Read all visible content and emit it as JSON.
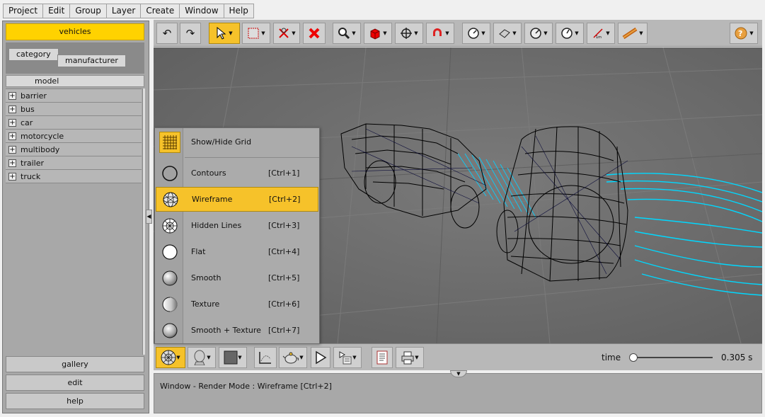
{
  "menubar": [
    "Project",
    "Edit",
    "Group",
    "Layer",
    "Create",
    "Window",
    "Help"
  ],
  "sidebar": {
    "active_tab": "vehicles",
    "filters": [
      "category",
      "manufacturer"
    ],
    "column_header": "model",
    "tree_items": [
      "barrier",
      "bus",
      "car",
      "motorcycle",
      "multibody",
      "trailer",
      "truck"
    ],
    "bottom_buttons": [
      "gallery",
      "edit",
      "help"
    ]
  },
  "render_menu": {
    "items": [
      {
        "label": "Show/Hide Grid",
        "shortcut": "",
        "icon": "grid-icon"
      },
      {
        "label": "Contours",
        "shortcut": "[Ctrl+1]",
        "icon": "contours-sphere-icon"
      },
      {
        "label": "Wireframe",
        "shortcut": "[Ctrl+2]",
        "icon": "wireframe-sphere-icon"
      },
      {
        "label": "Hidden Lines",
        "shortcut": "[Ctrl+3]",
        "icon": "hidden-lines-sphere-icon"
      },
      {
        "label": "Flat",
        "shortcut": "[Ctrl+4]",
        "icon": "flat-sphere-icon"
      },
      {
        "label": "Smooth",
        "shortcut": "[Ctrl+5]",
        "icon": "smooth-sphere-icon"
      },
      {
        "label": "Texture",
        "shortcut": "[Ctrl+6]",
        "icon": "texture-sphere-icon"
      },
      {
        "label": "Smooth + Texture",
        "shortcut": "[Ctrl+7]",
        "icon": "smooth-texture-sphere-icon"
      }
    ],
    "highlighted": "Wireframe"
  },
  "bottombar": {
    "time_label": "time",
    "time_value": "0.305 s",
    "slider_fraction": 0.02
  },
  "status": {
    "text": "Window - Render Mode : Wireframe [Ctrl+2]"
  },
  "colors": {
    "accent": "#f6c22a",
    "active_tab": "#ffd200",
    "panel": "#a8a8a8",
    "viewport": "#6a6a6a",
    "wire_cyan": "#00d8ff"
  }
}
